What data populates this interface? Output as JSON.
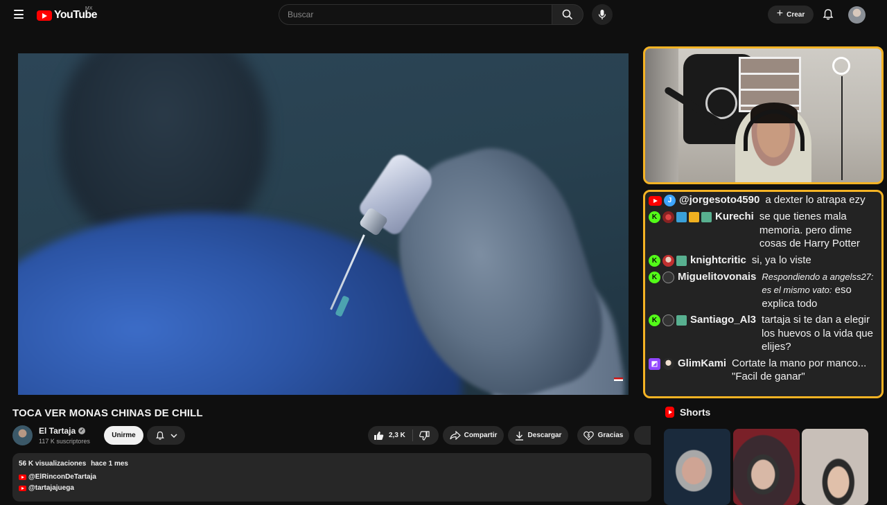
{
  "header": {
    "logo_text": "YouTube",
    "country_code": "MX",
    "search_placeholder": "Buscar",
    "create_label": "Crear"
  },
  "video": {
    "title": "TOCA VER MONAS CHINAS DE CHILL",
    "channel_name": "El Tartaja",
    "subscribers": "117 K suscriptores",
    "join_label": "Unirme",
    "likes": "2,3 K",
    "share_label": "Compartir",
    "download_label": "Descargar",
    "thanks_label": "Gracias"
  },
  "description": {
    "views": "56 K visualizaciones",
    "date": "hace 1 mes",
    "links": [
      "@ElRinconDeTartaja",
      "@tartajajuega"
    ]
  },
  "chat": {
    "messages": [
      {
        "platform": "youtube",
        "user": "@jorgesoto4590",
        "text": "a dexter lo atrapa ezy"
      },
      {
        "platform": "kick",
        "user": "Kurechi",
        "text": "se que tienes mala memoria. pero dime cosas de Harry Potter"
      },
      {
        "platform": "kick",
        "user": "knightcritic",
        "text": "si, ya lo viste"
      },
      {
        "platform": "kick",
        "user": "Miguelitovonais",
        "reply": "Respondiendo a angelss27: es el mismo vato:",
        "text": "eso explica todo"
      },
      {
        "platform": "kick",
        "user": "Santiago_Al3",
        "text": "tartaja si te dan a elegir los huevos o la vida que elijes?"
      },
      {
        "platform": "twitch",
        "user": "GlimKami",
        "text": "Cortate la mano por manco... \"Facil de ganar\""
      }
    ]
  },
  "shorts": {
    "title": "Shorts"
  },
  "colors": {
    "accent_border": "#f5b324",
    "youtube_red": "#ff0000",
    "kick_green": "#53fc18",
    "twitch_purple": "#9146ff"
  }
}
